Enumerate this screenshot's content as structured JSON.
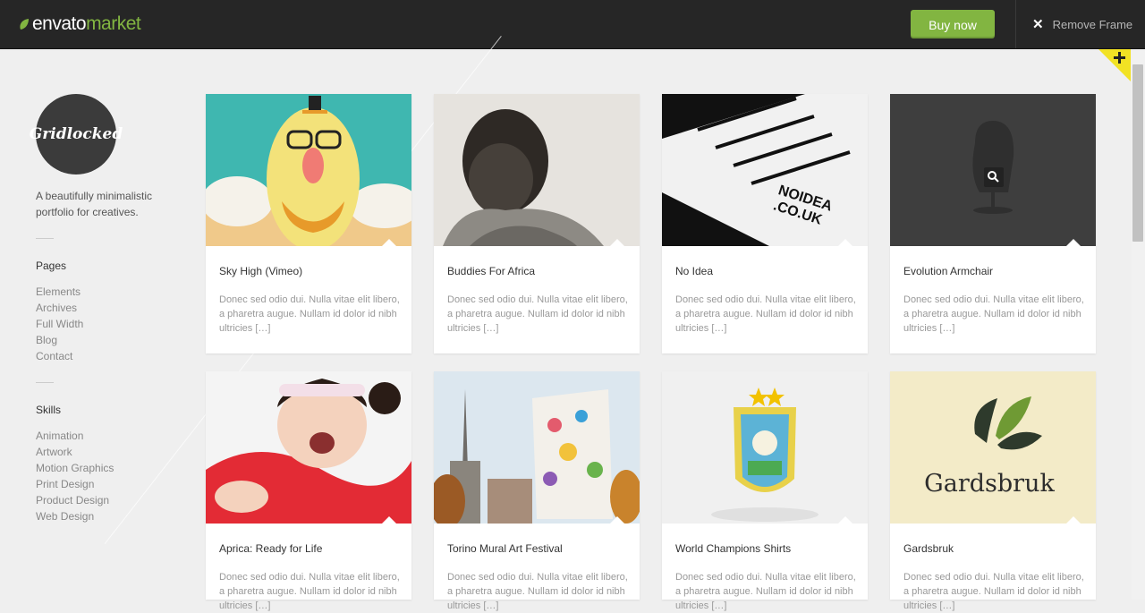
{
  "header": {
    "logo_envato": "envato",
    "logo_market": "market",
    "buy_label": "Buy now",
    "remove_frame_label": "Remove Frame",
    "accent": "#82b541"
  },
  "sidebar": {
    "logo_text": "Gridlocked",
    "tagline": "A beautifully minimalistic portfolio for creatives.",
    "pages_heading": "Pages",
    "pages": [
      "Elements",
      "Archives",
      "Full Width",
      "Blog",
      "Contact"
    ],
    "skills_heading": "Skills",
    "skills": [
      "Animation",
      "Artwork",
      "Motion Graphics",
      "Print Design",
      "Product Design",
      "Web Design"
    ]
  },
  "portfolio": {
    "excerpt": "Donec sed odio dui. Nulla vitae elit libero, a pharetra augue. Nullam id dolor id nibh ultricies […]",
    "items": [
      {
        "title": "Sky High (Vimeo)"
      },
      {
        "title": "Buddies For Africa"
      },
      {
        "title": "No Idea",
        "thumb_text_1": "NOIDEA",
        "thumb_text_2": ".CO.UK"
      },
      {
        "title": "Evolution Armchair"
      },
      {
        "title": "Aprica: Ready for Life"
      },
      {
        "title": "Torino Mural Art Festival"
      },
      {
        "title": "World Champions Shirts"
      },
      {
        "title": "Gardsbruk",
        "thumb_text_1": "Gardsbruk"
      }
    ]
  },
  "icons": {
    "leaf": "leaf-icon",
    "close": "close-icon",
    "plus": "plus-icon",
    "zoom": "magnifier-icon"
  }
}
